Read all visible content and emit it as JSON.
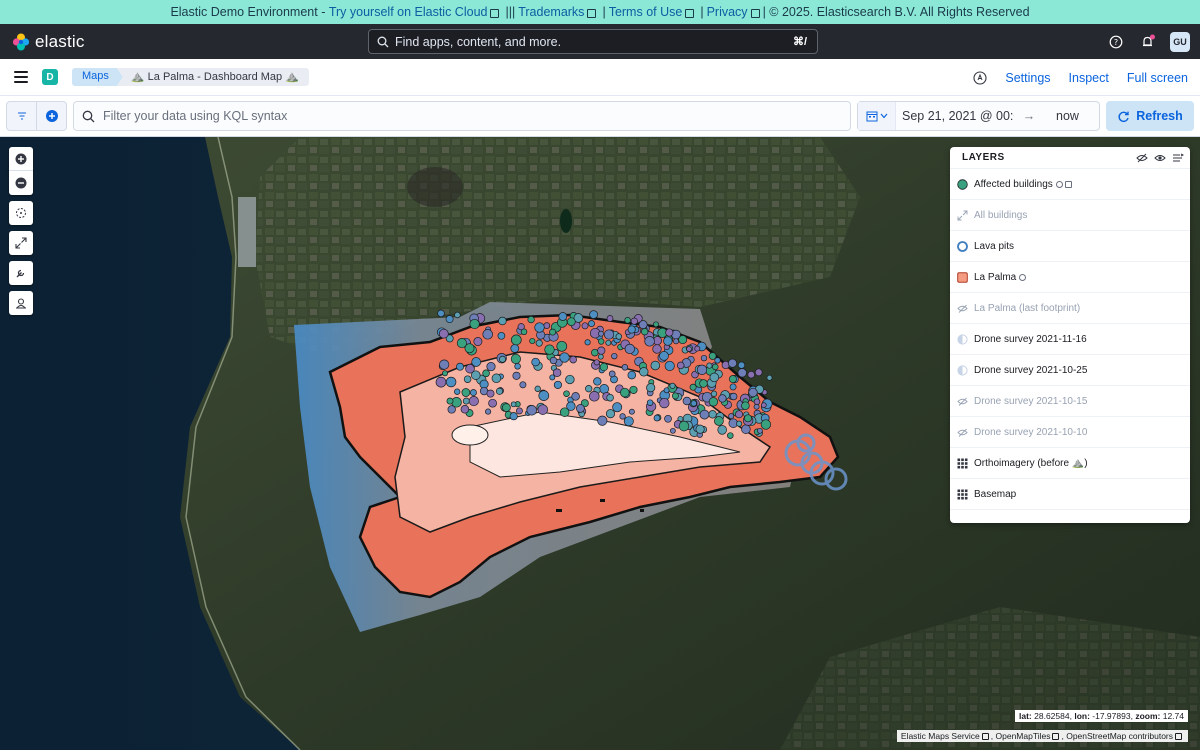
{
  "banner": {
    "prefix": "Elastic Demo Environment - ",
    "try_link": "Try yourself on Elastic Cloud",
    "trademarks": "Trademarks",
    "terms": "Terms of Use",
    "privacy": "Privacy",
    "copyright": "| © 2025. Elasticsearch B.V. All Rights Reserved",
    "separator": "|||"
  },
  "header": {
    "logo_text": "elastic",
    "search_placeholder": "Find apps, content, and more.",
    "search_shortcut": "⌘/",
    "avatar_initials": "GU"
  },
  "breadcrumbs": {
    "space_initial": "D",
    "app": "Maps",
    "current": "⛰️ La Palma - Dashboard Map ⛰️"
  },
  "actions": {
    "settings": "Settings",
    "inspect": "Inspect",
    "full_screen": "Full screen"
  },
  "query": {
    "placeholder": "Filter your data using KQL syntax",
    "date_start": "Sep 21, 2021 @ 00:0...",
    "arrow": "→",
    "date_end": "now",
    "refresh": "Refresh"
  },
  "layers_panel": {
    "title": "LAYERS",
    "items": [
      {
        "label": "Affected buildings",
        "swatch": "circle-fill",
        "color": "#3aa17e",
        "dim": false
      },
      {
        "label": "All buildings",
        "swatch": "expand",
        "color": "#98a2b3",
        "dim": true
      },
      {
        "label": "Lava pits",
        "swatch": "circle-ring",
        "color": "#3f7fbf",
        "dim": false
      },
      {
        "label": "La Palma",
        "swatch": "square-fill",
        "color": "#f39c82",
        "dim": false
      },
      {
        "label": "La Palma (last footprint)",
        "swatch": "eye-closed",
        "color": "#98a2b3",
        "dim": true
      },
      {
        "label": "Drone survey 2021-11-16",
        "swatch": "half-circle",
        "color": "#c7d3e6",
        "dim": false
      },
      {
        "label": "Drone survey 2021-10-25",
        "swatch": "half-circle",
        "color": "#c7d3e6",
        "dim": false
      },
      {
        "label": "Drone survey 2021-10-15",
        "swatch": "eye-closed",
        "color": "#98a2b3",
        "dim": true
      },
      {
        "label": "Drone survey 2021-10-10",
        "swatch": "eye-closed",
        "color": "#98a2b3",
        "dim": true
      },
      {
        "label": "Orthoimagery (before ⛰️)",
        "swatch": "grid",
        "color": "#343741",
        "dim": false
      },
      {
        "label": "Basemap",
        "swatch": "grid",
        "color": "#343741",
        "dim": false
      }
    ]
  },
  "map": {
    "coords_lat_label": "lat:",
    "coords_lat": "28.62584,",
    "coords_lon_label": "lon:",
    "coords_lon": "-17.97893,",
    "coords_zoom_label": "zoom:",
    "coords_zoom": "12.74",
    "attribution": [
      "Elastic Maps Service",
      "OpenMapTiles",
      "OpenStreetMap contributors"
    ]
  }
}
